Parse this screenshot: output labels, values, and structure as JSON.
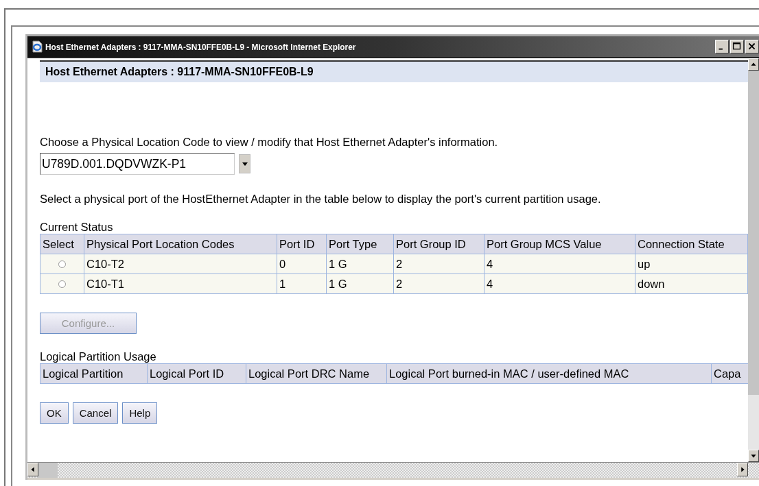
{
  "window": {
    "title": "Host Ethernet Adapters : 9117-MMA-SN10FFE0B-L9 - Microsoft Internet Explorer"
  },
  "page_header": "Host Ethernet Adapters : 9117-MMA-SN10FFE0B-L9",
  "location_prompt": "Choose a Physical Location Code to view / modify that Host Ethernet Adapter's information.",
  "location_select": {
    "value": "U789D.001.DQDVWZK-P1"
  },
  "port_instructions": "Select a physical port of the HostEthernet Adapter in the table below to display the port's current partition usage.",
  "current_status": {
    "title": "Current Status",
    "columns": [
      "Select",
      "Physical Port Location Codes",
      "Port ID",
      "Port Type",
      "Port Group ID",
      "Port Group MCS Value",
      "Connection State"
    ],
    "rows": [
      {
        "cells": [
          {
            "kind": "radio",
            "selected": false
          },
          "C10-T2",
          "0",
          "1 G",
          "2",
          "4",
          "up"
        ]
      },
      {
        "cells": [
          {
            "kind": "radio",
            "selected": false
          },
          "C10-T1",
          "1",
          "1 G",
          "2",
          "4",
          "down"
        ]
      }
    ]
  },
  "configure_button": {
    "label": "Configure...",
    "disabled": true
  },
  "partition_usage": {
    "title": "Logical Partition Usage",
    "columns": [
      "Logical Partition",
      "Logical Port ID",
      "Logical Port DRC Name",
      "Logical Port burned-in MAC / user-defined MAC",
      "Capa"
    ]
  },
  "buttons": [
    "OK",
    "Cancel",
    "Help"
  ]
}
